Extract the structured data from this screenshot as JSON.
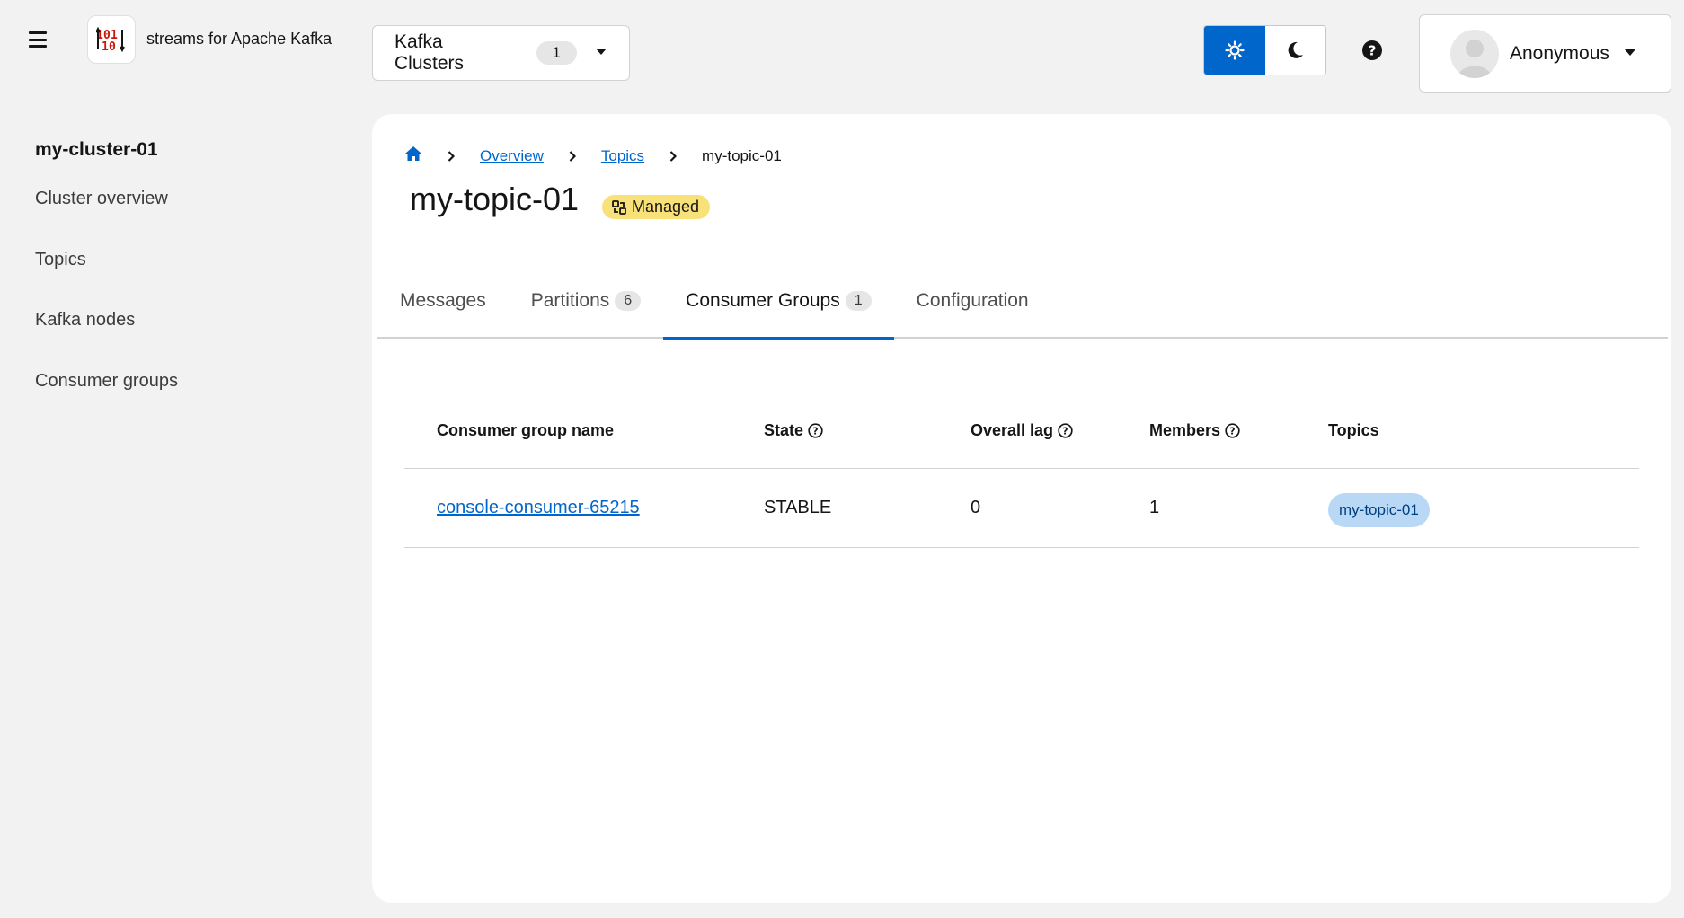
{
  "header": {
    "app_name": "streams for Apache Kafka",
    "cluster_selector": {
      "label": "Kafka Clusters",
      "count": "1"
    },
    "user": {
      "name": "Anonymous"
    },
    "theme": {
      "active": "light"
    }
  },
  "sidebar": {
    "cluster_name": "my-cluster-01",
    "items": [
      {
        "label": "Cluster overview"
      },
      {
        "label": "Topics"
      },
      {
        "label": "Kafka nodes"
      },
      {
        "label": "Consumer groups"
      }
    ]
  },
  "breadcrumb": {
    "items": [
      "Overview",
      "Topics"
    ],
    "current": "my-topic-01"
  },
  "page": {
    "title": "my-topic-01",
    "badge": "Managed"
  },
  "tabs": [
    {
      "label": "Messages",
      "count": null
    },
    {
      "label": "Partitions",
      "count": "6"
    },
    {
      "label": "Consumer Groups",
      "count": "1",
      "active": true
    },
    {
      "label": "Configuration",
      "count": null
    }
  ],
  "table": {
    "columns": [
      "Consumer group name",
      "State",
      "Overall lag",
      "Members",
      "Topics"
    ],
    "rows": [
      {
        "name": "console-consumer-65215",
        "state": "STABLE",
        "lag": "0",
        "members": "1",
        "topics": [
          "my-topic-01"
        ]
      }
    ]
  },
  "colors": {
    "accent": "#0066cc",
    "badge_bg": "#f9e17a",
    "chip_bg": "#b9d8f6"
  }
}
